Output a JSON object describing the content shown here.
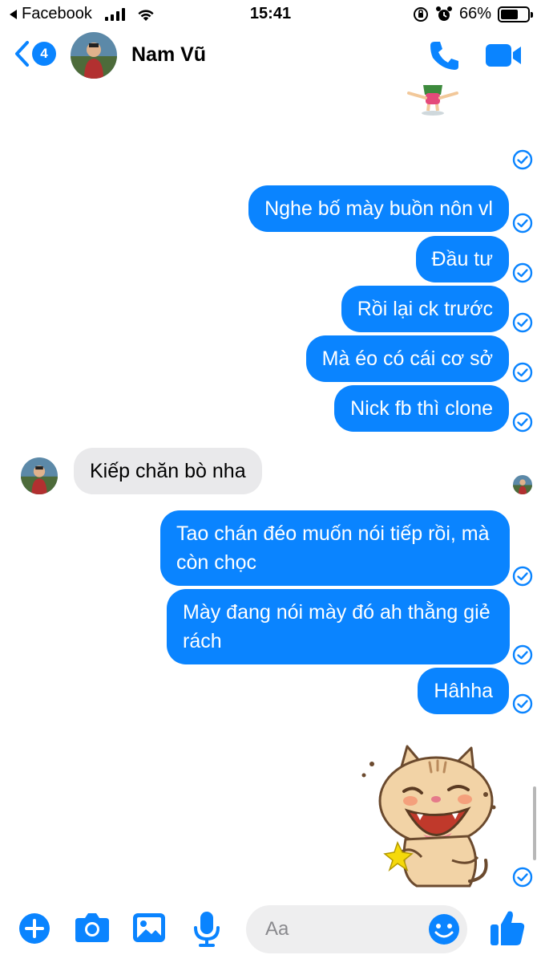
{
  "status_bar": {
    "back_app": "Facebook",
    "time": "15:41",
    "battery": "66%",
    "battery_level": 0.66
  },
  "header": {
    "unread_count": "4",
    "contact_name": "Nam Vũ"
  },
  "messages": [
    {
      "from": "me",
      "text": "Nghe bố mày buồn nôn vl"
    },
    {
      "from": "me",
      "text": "Đầu tư"
    },
    {
      "from": "me",
      "text": "Rồi lại ck trước"
    },
    {
      "from": "me",
      "text": "Mà éo có cái cơ sở"
    },
    {
      "from": "me",
      "text": "Nick fb thì clone"
    },
    {
      "from": "them",
      "text": "Kiếp chăn bò nha"
    },
    {
      "from": "me",
      "text": "Tao chán đéo muốn nói tiếp rồi, mà còn chọc"
    },
    {
      "from": "me",
      "text": "Mày đang nói mày đó ah thằng giẻ rách"
    },
    {
      "from": "me",
      "text": "Hâhha"
    }
  ],
  "composer": {
    "placeholder": "Aa"
  },
  "colors": {
    "accent": "#0a84ff",
    "incoming_bubble": "#e9e9eb"
  },
  "icons": [
    "back-chevron-icon",
    "phone-icon",
    "video-camera-icon",
    "plus-icon",
    "camera-icon",
    "gallery-icon",
    "microphone-icon",
    "emoji-icon",
    "thumbs-up-icon",
    "sent-check-icon"
  ]
}
